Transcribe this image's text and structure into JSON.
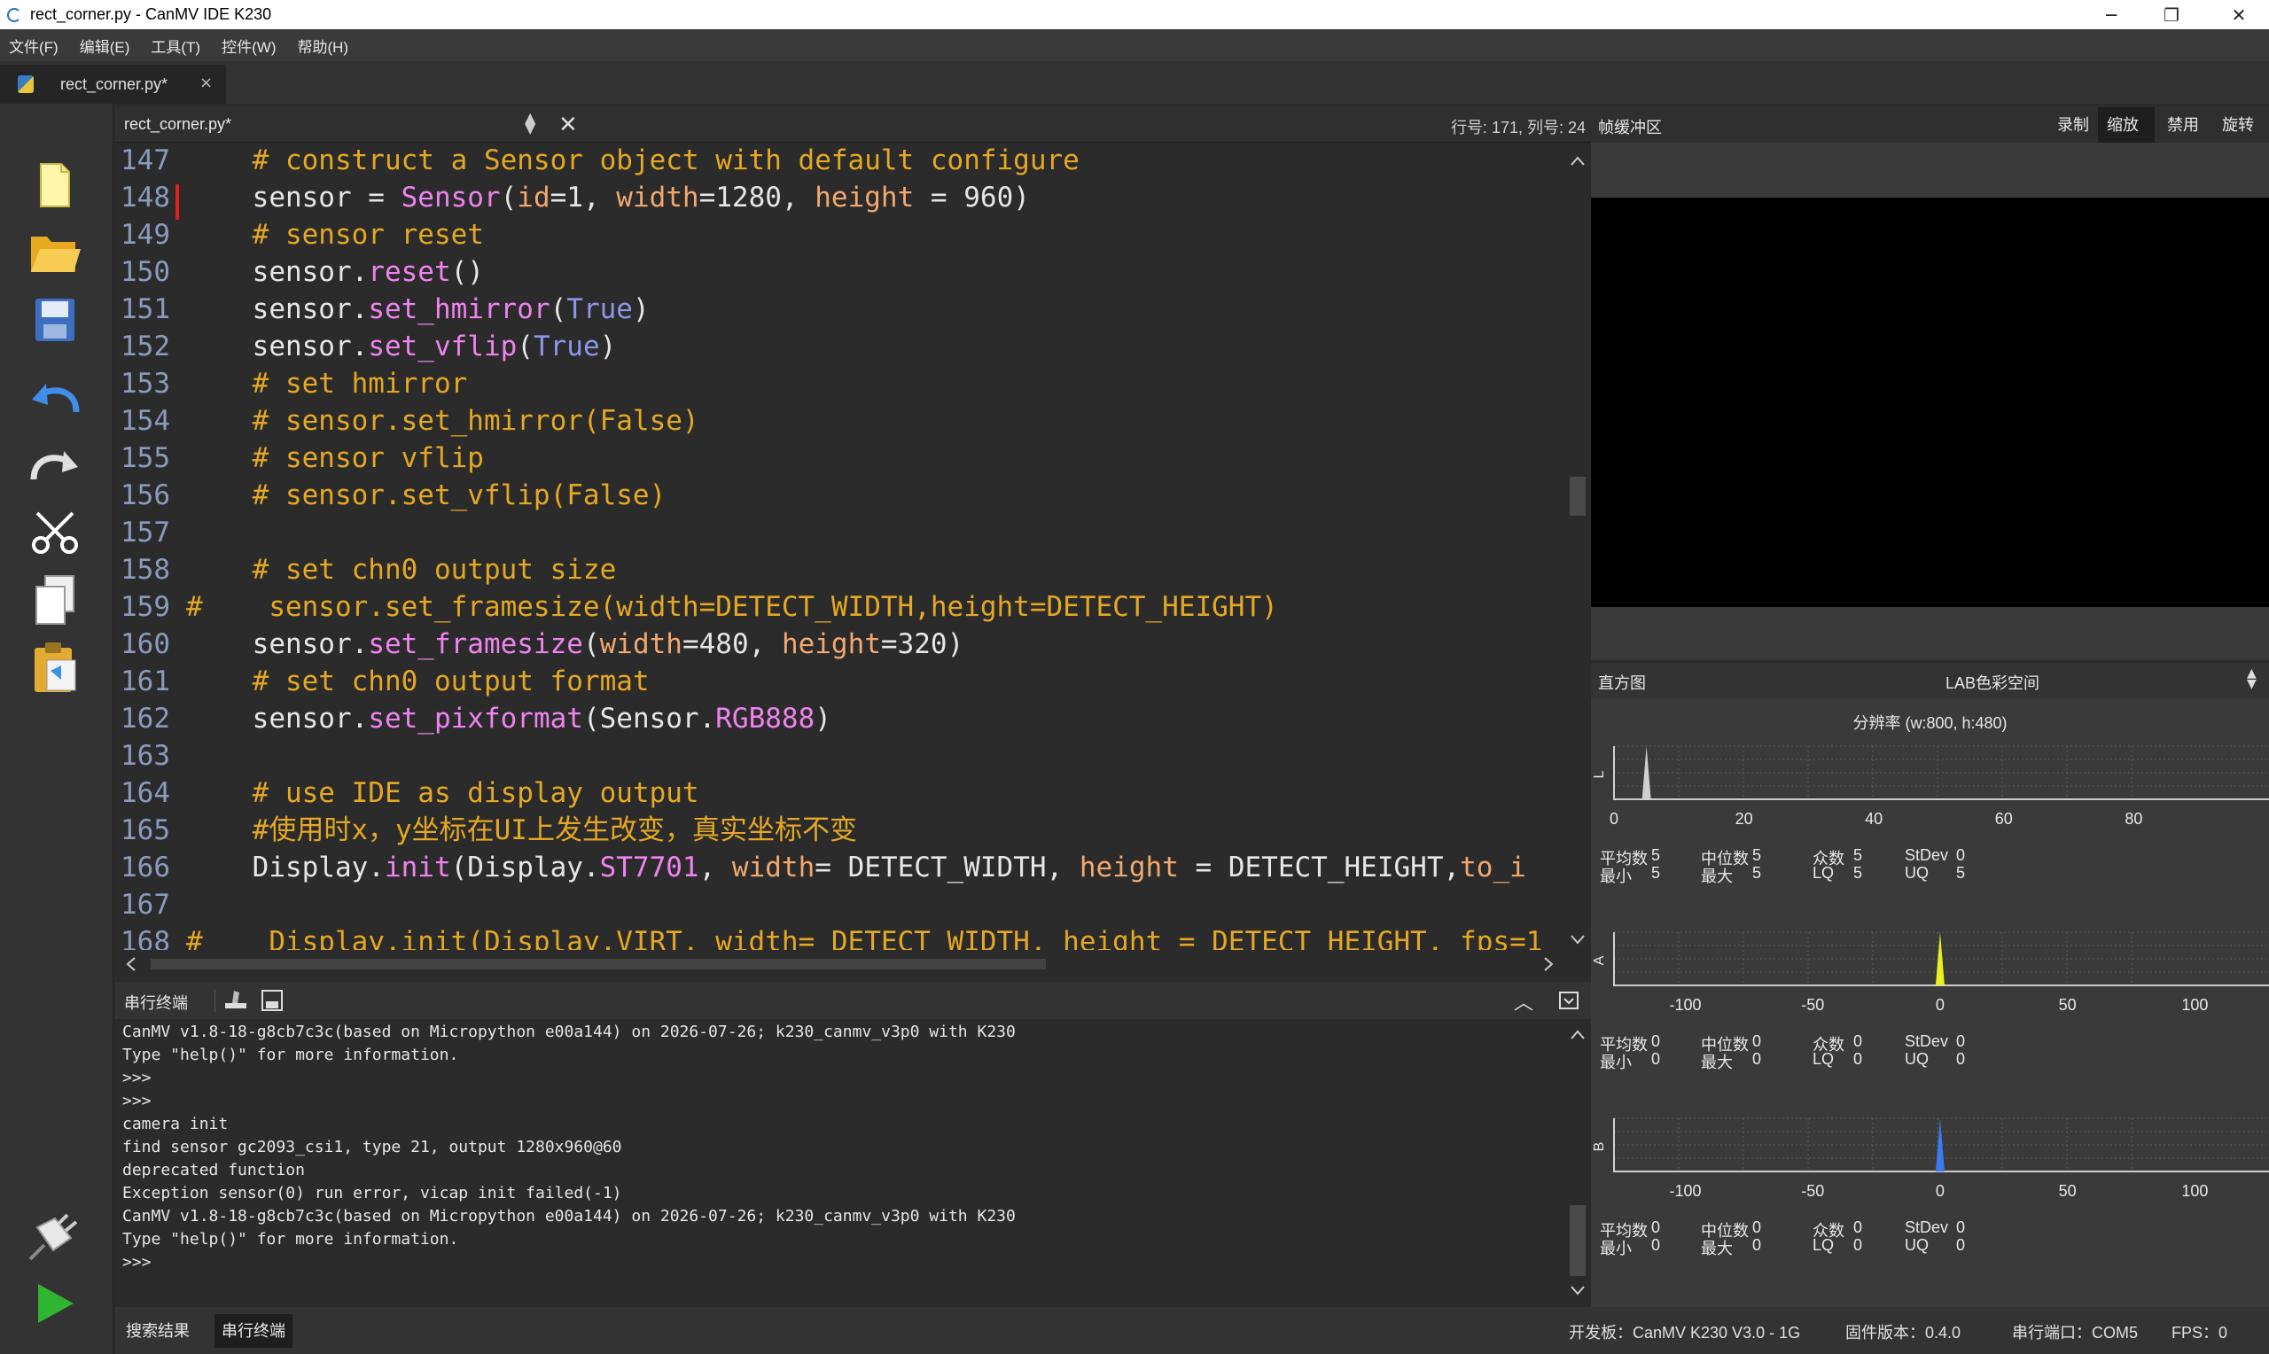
{
  "window": {
    "title": "rect_corner.py - CanMV IDE K230",
    "minimize": "─",
    "restore": "❐",
    "close": "✕"
  },
  "menu": [
    "文件(F)",
    "编辑(E)",
    "工具(T)",
    "控件(W)",
    "帮助(H)"
  ],
  "file_tab": {
    "label": "rect_corner.py*",
    "close": "×"
  },
  "toolbar_icons": [
    "new-file-icon",
    "open-folder-icon",
    "save-icon",
    "undo-icon",
    "redo-icon",
    "cut-icon",
    "copy-icon",
    "paste-icon",
    "connect-icon",
    "run-icon"
  ],
  "editor": {
    "filename": "rect_corner.py*",
    "cursor_pos": "行号: 171, 列号: 24",
    "lines": [
      {
        "n": "147",
        "segs": [
          [
            "cm",
            "    # construct a Sensor object with default configure"
          ]
        ]
      },
      {
        "n": "148",
        "segs": [
          [
            "",
            "    sensor = "
          ],
          [
            "fn",
            "Sensor"
          ],
          [
            "",
            "("
          ],
          [
            "kw",
            "id"
          ],
          [
            "",
            "=1, "
          ],
          [
            "kw",
            "width"
          ],
          [
            "",
            "=1280, "
          ],
          [
            "kw",
            "height"
          ],
          [
            "",
            " = 960)"
          ]
        ]
      },
      {
        "n": "149",
        "segs": [
          [
            "cm",
            "    # sensor reset"
          ]
        ]
      },
      {
        "n": "150",
        "segs": [
          [
            "",
            "    sensor."
          ],
          [
            "fn",
            "reset"
          ],
          [
            "",
            "()"
          ]
        ]
      },
      {
        "n": "151",
        "segs": [
          [
            "",
            "    sensor."
          ],
          [
            "fn",
            "set_hmirror"
          ],
          [
            "",
            "("
          ],
          [
            "kc",
            "True"
          ],
          [
            "",
            ")"
          ]
        ]
      },
      {
        "n": "152",
        "segs": [
          [
            "",
            "    sensor."
          ],
          [
            "fn",
            "set_vflip"
          ],
          [
            "",
            "("
          ],
          [
            "kc",
            "True"
          ],
          [
            "",
            ")"
          ]
        ]
      },
      {
        "n": "153",
        "segs": [
          [
            "cm",
            "    # set hmirror"
          ]
        ]
      },
      {
        "n": "154",
        "segs": [
          [
            "cm",
            "    # sensor.set_hmirror(False)"
          ]
        ]
      },
      {
        "n": "155",
        "segs": [
          [
            "cm",
            "    # sensor vflip"
          ]
        ]
      },
      {
        "n": "156",
        "segs": [
          [
            "cm",
            "    # sensor.set_vflip(False)"
          ]
        ]
      },
      {
        "n": "157",
        "segs": [
          [
            "",
            ""
          ]
        ]
      },
      {
        "n": "158",
        "segs": [
          [
            "cm",
            "    # set chn0 output size"
          ]
        ]
      },
      {
        "n": "159",
        "segs": [
          [
            "cm",
            "#    sensor.set_framesize(width=DETECT_WIDTH,height=DETECT_HEIGHT)"
          ]
        ]
      },
      {
        "n": "160",
        "segs": [
          [
            "",
            "    sensor."
          ],
          [
            "fn",
            "set_framesize"
          ],
          [
            "",
            "("
          ],
          [
            "kw",
            "width"
          ],
          [
            "",
            "=480, "
          ],
          [
            "kw",
            "height"
          ],
          [
            "",
            "=320)"
          ]
        ]
      },
      {
        "n": "161",
        "segs": [
          [
            "cm",
            "    # set chn0 output format"
          ]
        ]
      },
      {
        "n": "162",
        "segs": [
          [
            "",
            "    sensor."
          ],
          [
            "fn",
            "set_pixformat"
          ],
          [
            "",
            "(Sensor."
          ],
          [
            "cst",
            "RGB888"
          ],
          [
            "",
            ")"
          ]
        ]
      },
      {
        "n": "163",
        "segs": [
          [
            "",
            ""
          ]
        ]
      },
      {
        "n": "164",
        "segs": [
          [
            "cm",
            "    # use IDE as display output"
          ]
        ]
      },
      {
        "n": "165",
        "segs": [
          [
            "cm",
            "    #使用时x，y坐标在UI上发生改变，真实坐标不变"
          ]
        ]
      },
      {
        "n": "166",
        "segs": [
          [
            "",
            "    Display."
          ],
          [
            "fn",
            "init"
          ],
          [
            "",
            "(Display."
          ],
          [
            "cst",
            "ST7701"
          ],
          [
            "",
            ", "
          ],
          [
            "kw",
            "width"
          ],
          [
            "",
            "= DETECT_WIDTH, "
          ],
          [
            "kw",
            "height"
          ],
          [
            "",
            " = DETECT_HEIGHT,"
          ],
          [
            "kw",
            "to_i"
          ]
        ]
      },
      {
        "n": "167",
        "segs": [
          [
            "",
            ""
          ]
        ]
      },
      {
        "n": "168",
        "segs": [
          [
            "cm",
            "#    Display.init(Display.VIRT, width= DETECT_WIDTH, height = DETECT_HEIGHT, fps=1"
          ]
        ]
      }
    ]
  },
  "terminal": {
    "title": "串行终端",
    "lines": [
      "CanMV v1.8-18-g8cb7c3c(based on Micropython e00a144) on 2026-07-26; k230_canmv_v3p0 with K230",
      "Type \"help()\" for more information.",
      ">>>",
      ">>>",
      "camera init",
      "find sensor gc2093_csi1, type 21, output 1280x960@60",
      "deprecated function",
      "Exception sensor(0) run error, vicap init failed(-1)",
      "CanMV v1.8-18-g8cb7c3c(based on Micropython e00a144) on 2026-07-26; k230_canmv_v3p0 with K230",
      "Type \"help()\" for more information.",
      ">>>"
    ]
  },
  "statusbar": {
    "tabs": [
      "搜索结果",
      "串行终端"
    ],
    "board": "开发板：CanMV K230 V3.0 - 1G",
    "firmware": "固件版本：0.4.0",
    "port": "串行端口：COM5",
    "fps": "FPS：0"
  },
  "framebuffer": {
    "title": "帧缓冲区",
    "buttons": [
      "录制",
      "缩放",
      "禁用",
      "旋转"
    ],
    "active_button": "缩放"
  },
  "histogram": {
    "title": "直方图",
    "colorspace": "LAB色彩空间",
    "resolution": "分辨率 (w:800, h:480)",
    "labels": {
      "mean": "平均数",
      "median": "中位数",
      "mode": "众数",
      "stdev": "StDev",
      "min": "最小",
      "max": "最大",
      "lq": "LQ",
      "uq": "UQ"
    },
    "channels": [
      {
        "name": "L",
        "color": "#cfcfcf",
        "ticks": [
          "0",
          "20",
          "40",
          "60",
          "80"
        ],
        "peak_value": 5,
        "stats": {
          "mean": "5",
          "median": "5",
          "mode": "5",
          "stdev": "0",
          "min": "5",
          "max": "5",
          "lq": "5",
          "uq": "5"
        }
      },
      {
        "name": "A",
        "color": "#e8f020",
        "ticks": [
          "-100",
          "-50",
          "0",
          "50",
          "100"
        ],
        "peak_value": 0,
        "stats": {
          "mean": "0",
          "median": "0",
          "mode": "0",
          "stdev": "0",
          "min": "0",
          "max": "0",
          "lq": "0",
          "uq": "0"
        }
      },
      {
        "name": "B",
        "color": "#3a7cf0",
        "ticks": [
          "-100",
          "-50",
          "0",
          "50",
          "100"
        ],
        "peak_value": 0,
        "stats": {
          "mean": "0",
          "median": "0",
          "mode": "0",
          "stdev": "0",
          "min": "0",
          "max": "0",
          "lq": "0",
          "uq": "0"
        }
      }
    ]
  }
}
